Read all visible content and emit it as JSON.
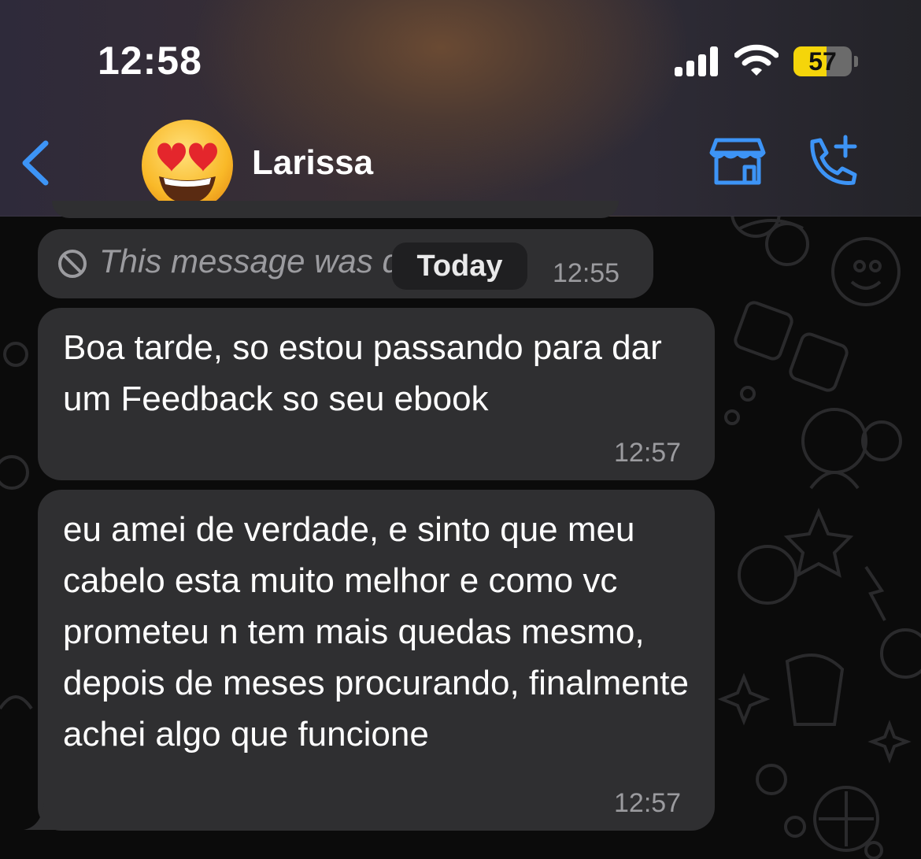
{
  "status_bar": {
    "time": "12:58",
    "battery": "57",
    "battery_level": 0.57,
    "battery_color": "#f5d50a"
  },
  "header": {
    "back_icon": "chevron-left-icon",
    "contact_name": "Larissa",
    "avatar_emoji": "😍",
    "store_icon": "storefront-icon",
    "call_icon": "add-call-icon",
    "accent_color": "#3d94f6"
  },
  "messages": [
    {
      "type": "deleted",
      "text": "This message was deleted",
      "time": "12:55"
    },
    {
      "type": "incoming",
      "text": "Boa tarde, so estou passando para dar um Feedback so seu ebook",
      "time": "12:57"
    },
    {
      "type": "incoming",
      "text": "eu amei de verdade, e sinto que meu cabelo esta muito melhor e como vc prometeu n tem mais quedas mesmo, depois de meses procurando, finalmente achei algo que funcione",
      "time": "12:57"
    }
  ],
  "date_separator": "Today"
}
